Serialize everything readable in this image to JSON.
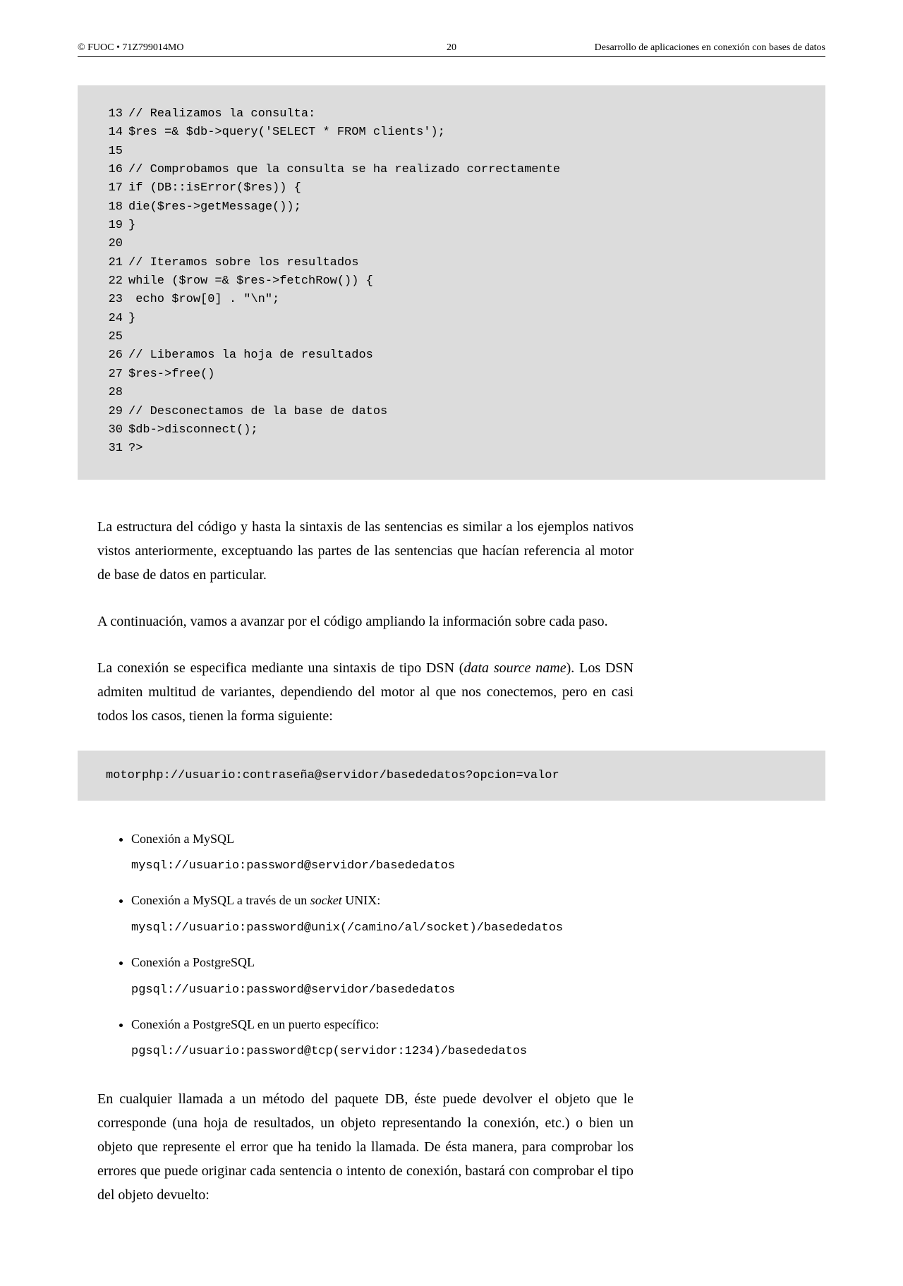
{
  "header": {
    "left": "© FUOC • 71Z799014MO",
    "center": "20",
    "right": "Desarrollo de aplicaciones en conexión con bases de datos"
  },
  "code_block_1": [
    {
      "n": "13",
      "t": "// Realizamos la consulta:"
    },
    {
      "n": "14",
      "t": "$res =& $db->query('SELECT * FROM clients');"
    },
    {
      "n": "15",
      "t": ""
    },
    {
      "n": "16",
      "t": "// Comprobamos que la consulta se ha realizado correctamente"
    },
    {
      "n": "17",
      "t": "if (DB::isError($res)) {"
    },
    {
      "n": "18",
      "t": "die($res->getMessage());"
    },
    {
      "n": "19",
      "t": "}"
    },
    {
      "n": "20",
      "t": ""
    },
    {
      "n": "21",
      "t": "// Iteramos sobre los resultados"
    },
    {
      "n": "22",
      "t": "while ($row =& $res->fetchRow()) {"
    },
    {
      "n": "23",
      "t": " echo $row[0] . \"\\n\";"
    },
    {
      "n": "24",
      "t": "}"
    },
    {
      "n": "25",
      "t": ""
    },
    {
      "n": "26",
      "t": "// Liberamos la hoja de resultados"
    },
    {
      "n": "27",
      "t": "$res->free()"
    },
    {
      "n": "28",
      "t": ""
    },
    {
      "n": "29",
      "t": "// Desconectamos de la base de datos"
    },
    {
      "n": "30",
      "t": "$db->disconnect();"
    },
    {
      "n": "31",
      "t": "?>"
    }
  ],
  "para1": "La estructura del código y hasta la sintaxis de las sentencias es similar a los ejemplos nativos vistos anteriormente, exceptuando las partes de las sentencias que hacían referencia al motor de base de datos en particular.",
  "para2": "A continuación, vamos a avanzar por el código ampliando la información sobre cada paso.",
  "para3_pre": "La conexión se especifica mediante una sintaxis de tipo DSN (",
  "para3_em": "data source name",
  "para3_post": "). Los DSN admiten multitud de variantes, dependiendo del motor al que nos conectemos, pero en casi todos los casos, tienen la forma siguiente:",
  "dsn_template": "motorphp://usuario:contraseña@servidor/basededatos?opcion=valor",
  "bullets": [
    {
      "label": "Conexión a MySQL",
      "code": "mysql://usuario:password@servidor/basededatos"
    },
    {
      "label_pre": "Conexión a MySQL a través de un ",
      "label_em": "socket",
      "label_post": " UNIX:",
      "code": "mysql://usuario:password@unix(/camino/al/socket)/basededatos"
    },
    {
      "label": "Conexión a PostgreSQL",
      "code": "pgsql://usuario:password@servidor/basededatos"
    },
    {
      "label": "Conexión a PostgreSQL en un puerto específico:",
      "code": "pgsql://usuario:password@tcp(servidor:1234)/basededatos"
    }
  ],
  "para4": "En cualquier llamada a un método del paquete DB, éste puede devolver el objeto que le corresponde (una hoja de resultados, un objeto representando la conexión, etc.) o bien un objeto que represente el error que ha tenido la llamada. De ésta manera, para comprobar los errores que puede originar cada sentencia o intento de conexión, bastará con comprobar el tipo del objeto devuelto:"
}
